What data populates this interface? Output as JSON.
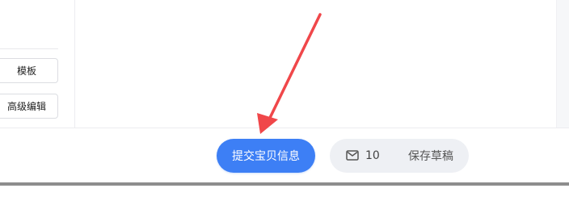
{
  "sidebar": {
    "template_label": "模板",
    "advanced_edit_label": "高级编辑"
  },
  "footer": {
    "submit_label": "提交宝贝信息",
    "message_count": "10",
    "save_draft_label": "保存草稿",
    "message_icon": "mail-icon"
  },
  "colors": {
    "primary": "#3d7ff5",
    "secondary_bg": "#eef0f4",
    "annotation_arrow": "#f0474a"
  }
}
